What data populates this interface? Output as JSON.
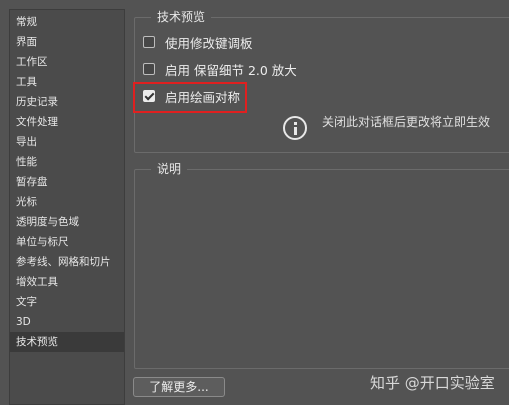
{
  "sidebar": {
    "items": [
      {
        "label": "常规"
      },
      {
        "label": "界面"
      },
      {
        "label": "工作区"
      },
      {
        "label": "工具"
      },
      {
        "label": "历史记录"
      },
      {
        "label": "文件处理"
      },
      {
        "label": "导出"
      },
      {
        "label": "性能"
      },
      {
        "label": "暂存盘"
      },
      {
        "label": "光标"
      },
      {
        "label": "透明度与色域"
      },
      {
        "label": "单位与标尺"
      },
      {
        "label": "参考线、网格和切片"
      },
      {
        "label": "增效工具"
      },
      {
        "label": "文字"
      },
      {
        "label": "3D"
      },
      {
        "label": "技术预览"
      }
    ],
    "active_index": 16
  },
  "tech_preview": {
    "title": "技术预览",
    "options": [
      {
        "label": "使用修改键调板",
        "checked": false
      },
      {
        "label": "启用 保留细节 2.0 放大",
        "checked": false
      },
      {
        "label": "启用绘画对称",
        "checked": true
      }
    ],
    "info_text": "关闭此对话框后更改将立即生效"
  },
  "description": {
    "title": "说明"
  },
  "learn_more_label": "了解更多...",
  "watermark": "知乎 @开口实验室",
  "colors": {
    "highlight": "#e02020",
    "background": "#535353"
  }
}
